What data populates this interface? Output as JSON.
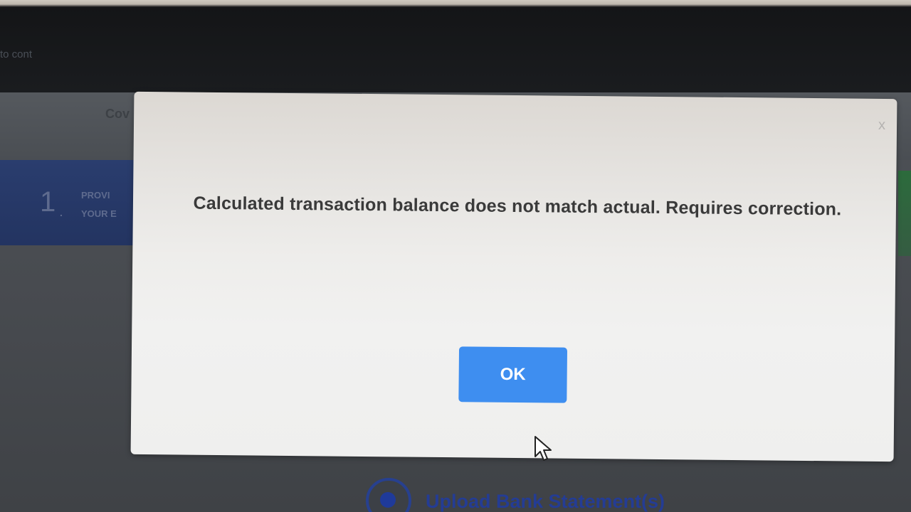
{
  "background": {
    "top_link_text": "to cont",
    "mid_partial_text": "Cov",
    "step": {
      "number": "1",
      "dot": ".",
      "line1": "PROVI",
      "line2": "YOUR E"
    },
    "upload_option_label": "Upload Bank Statement(s)"
  },
  "modal": {
    "close_label": "x",
    "message": "Calculated transaction balance does not match actual. Requires correction.",
    "ok_label": "OK"
  },
  "colors": {
    "ok_button": "#3e8ef0",
    "step_panel": "#2a3d6e",
    "upload_label": "#243c94"
  },
  "icons": {
    "cursor": "mouse-pointer-icon",
    "radio": "radio-selected-icon",
    "close": "close-icon"
  }
}
